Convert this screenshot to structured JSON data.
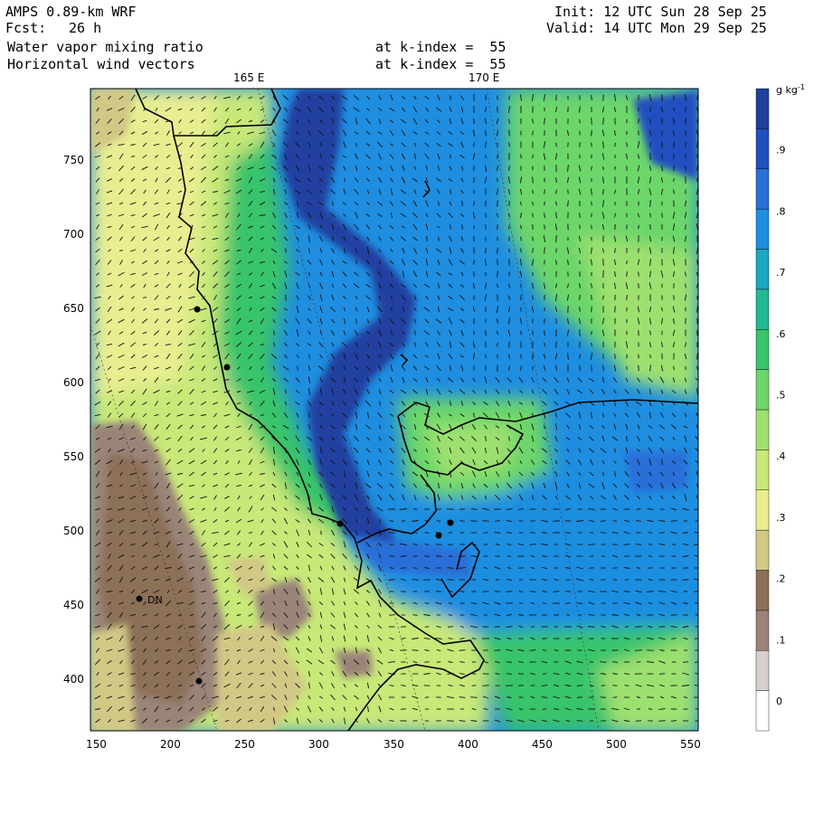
{
  "header": {
    "model": "AMPS 0.89-km WRF",
    "fcst_label": "Fcst:",
    "fcst_value": "26 h",
    "init": "Init: 12 UTC Sun 28 Sep 25",
    "valid": "Valid: 14 UTC Mon 29 Sep 25",
    "field1": "Water vapor mixing ratio",
    "field1_level": "at k-index =  55",
    "field2": "Horizontal wind vectors",
    "field2_level": "at k-index =  55"
  },
  "map": {
    "lon_labels": [
      "165 E",
      "170 E"
    ],
    "x_ticks": [
      "150",
      "200",
      "250",
      "300",
      "350",
      "400",
      "450",
      "500",
      "550"
    ],
    "y_ticks": [
      "750",
      "700",
      "650",
      "600",
      "550",
      "500",
      "450",
      "400"
    ],
    "x_range": [
      147,
      555
    ],
    "y_range": [
      365,
      795
    ],
    "station_label": "DN"
  },
  "colorbar": {
    "unit": "g kg⁻¹",
    "labels": [
      ".9",
      ".8",
      ".7",
      ".6",
      ".5",
      ".4",
      ".3",
      ".2",
      ".1",
      "0"
    ],
    "colors": [
      "#ffffff",
      "#d8d0cc",
      "#9a8478",
      "#8c7058",
      "#d2c886",
      "#e8ee90",
      "#c8e878",
      "#9ee070",
      "#6cd66a",
      "#38c46a",
      "#22b890",
      "#1aa8c0",
      "#1f8ee0",
      "#2a6ed8",
      "#2050c0",
      "#2040a0"
    ],
    "scale_max": 1.0
  }
}
